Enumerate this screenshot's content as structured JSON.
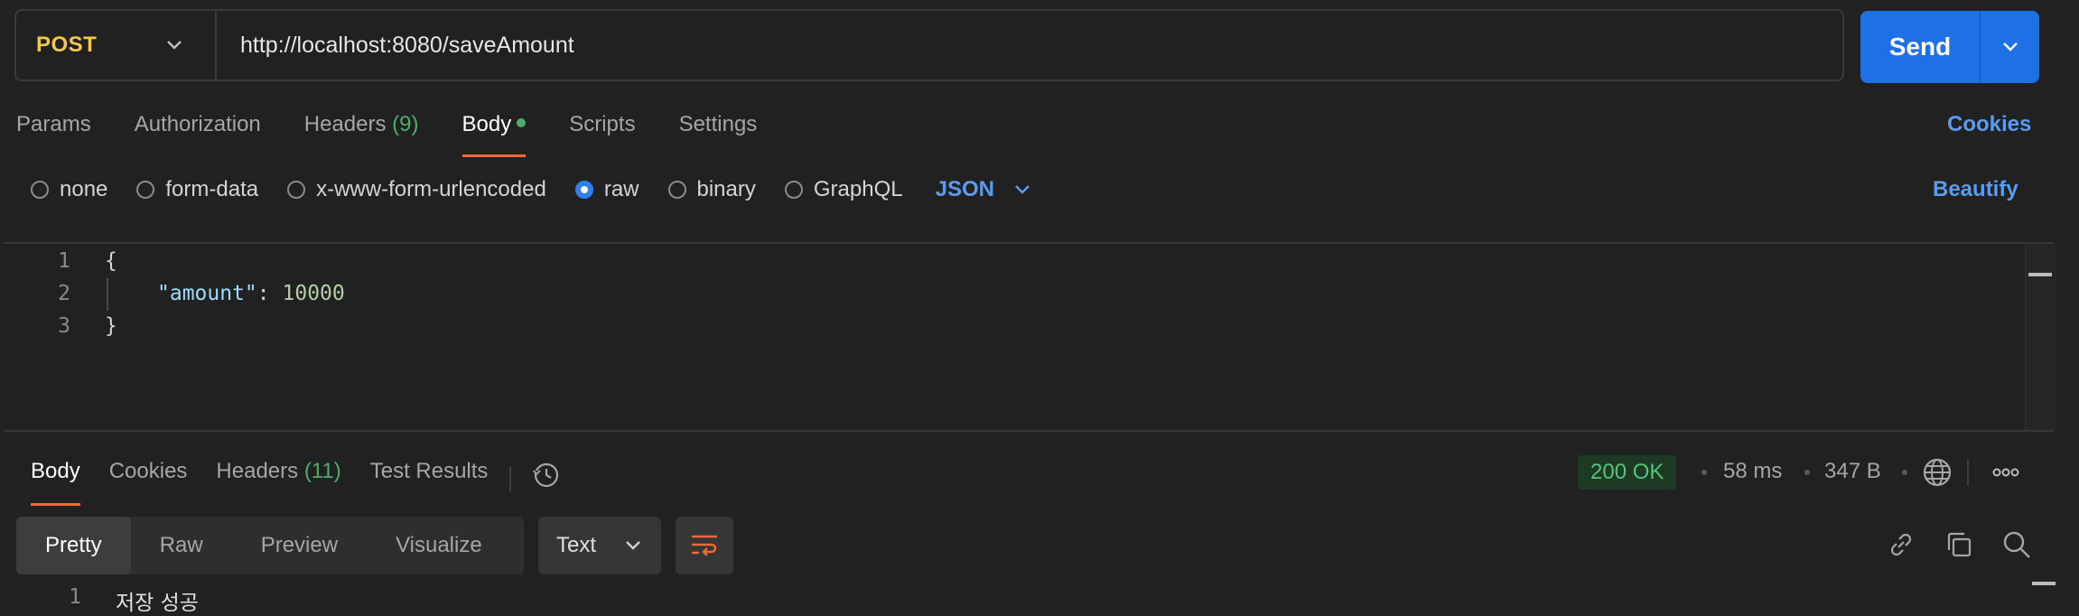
{
  "request": {
    "method": "POST",
    "url": "http://localhost:8080/saveAmount",
    "send_label": "Send"
  },
  "tabs": [
    {
      "label": "Params"
    },
    {
      "label": "Authorization"
    },
    {
      "label": "Headers",
      "count": "(9)"
    },
    {
      "label": "Body",
      "active": true,
      "dot": true
    },
    {
      "label": "Scripts"
    },
    {
      "label": "Settings"
    }
  ],
  "cookies_label": "Cookies",
  "body_types": [
    "none",
    "form-data",
    "x-www-form-urlencoded",
    "raw",
    "binary",
    "GraphQL"
  ],
  "body_type_selected": "raw",
  "format": "JSON",
  "beautify_label": "Beautify",
  "editor": {
    "lines": [
      "1",
      "2",
      "3"
    ],
    "open_brace": "{",
    "key": "\"amount\"",
    "colon": ":",
    "value": "10000",
    "close_brace": "}"
  },
  "response": {
    "tabs": [
      {
        "label": "Body",
        "active": true
      },
      {
        "label": "Cookies"
      },
      {
        "label": "Headers",
        "count": "(11)"
      },
      {
        "label": "Test Results"
      }
    ],
    "status": "200 OK",
    "time": "58 ms",
    "size": "347 B",
    "view_modes": [
      "Pretty",
      "Raw",
      "Preview",
      "Visualize"
    ],
    "view_mode_selected": "Pretty",
    "text_format": "Text",
    "line_number": "1",
    "line_text": "저장 성공"
  },
  "colors": {
    "accent": "#1f6fe5",
    "method": "#f2c94c",
    "tab_underline": "#f06a35",
    "success": "#56c27a",
    "link": "#5a9cf0"
  }
}
